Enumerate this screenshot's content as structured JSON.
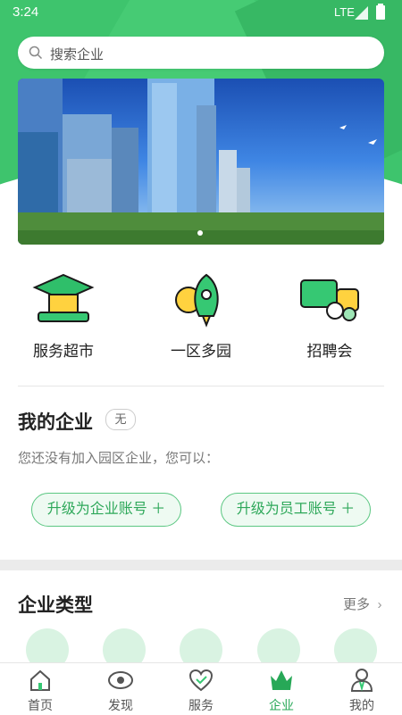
{
  "status_bar": {
    "time": "3:24",
    "network": "LTE"
  },
  "search": {
    "placeholder": "搜索企业"
  },
  "features": [
    {
      "label": "服务超市",
      "icon": "graduation-cap-icon"
    },
    {
      "label": "一区多园",
      "icon": "rocket-icon"
    },
    {
      "label": "招聘会",
      "icon": "recruitment-chat-icon"
    }
  ],
  "my_company": {
    "title": "我的企业",
    "badge": "无",
    "description": "您还没有加入园区企业，您可以：",
    "upgrade_enterprise": "升级为企业账号 ＋",
    "upgrade_employee": "升级为员工账号 ＋"
  },
  "company_types": {
    "title": "企业类型",
    "more": "更多"
  },
  "bottom_nav": [
    {
      "label": "首页",
      "icon": "home-icon"
    },
    {
      "label": "发现",
      "icon": "eye-icon"
    },
    {
      "label": "服务",
      "icon": "heart-icon"
    },
    {
      "label": "企业",
      "icon": "crown-icon",
      "active": true
    },
    {
      "label": "我的",
      "icon": "user-icon"
    }
  ],
  "colors": {
    "accent": "#3ec46d",
    "active_nav": "#27a857"
  }
}
